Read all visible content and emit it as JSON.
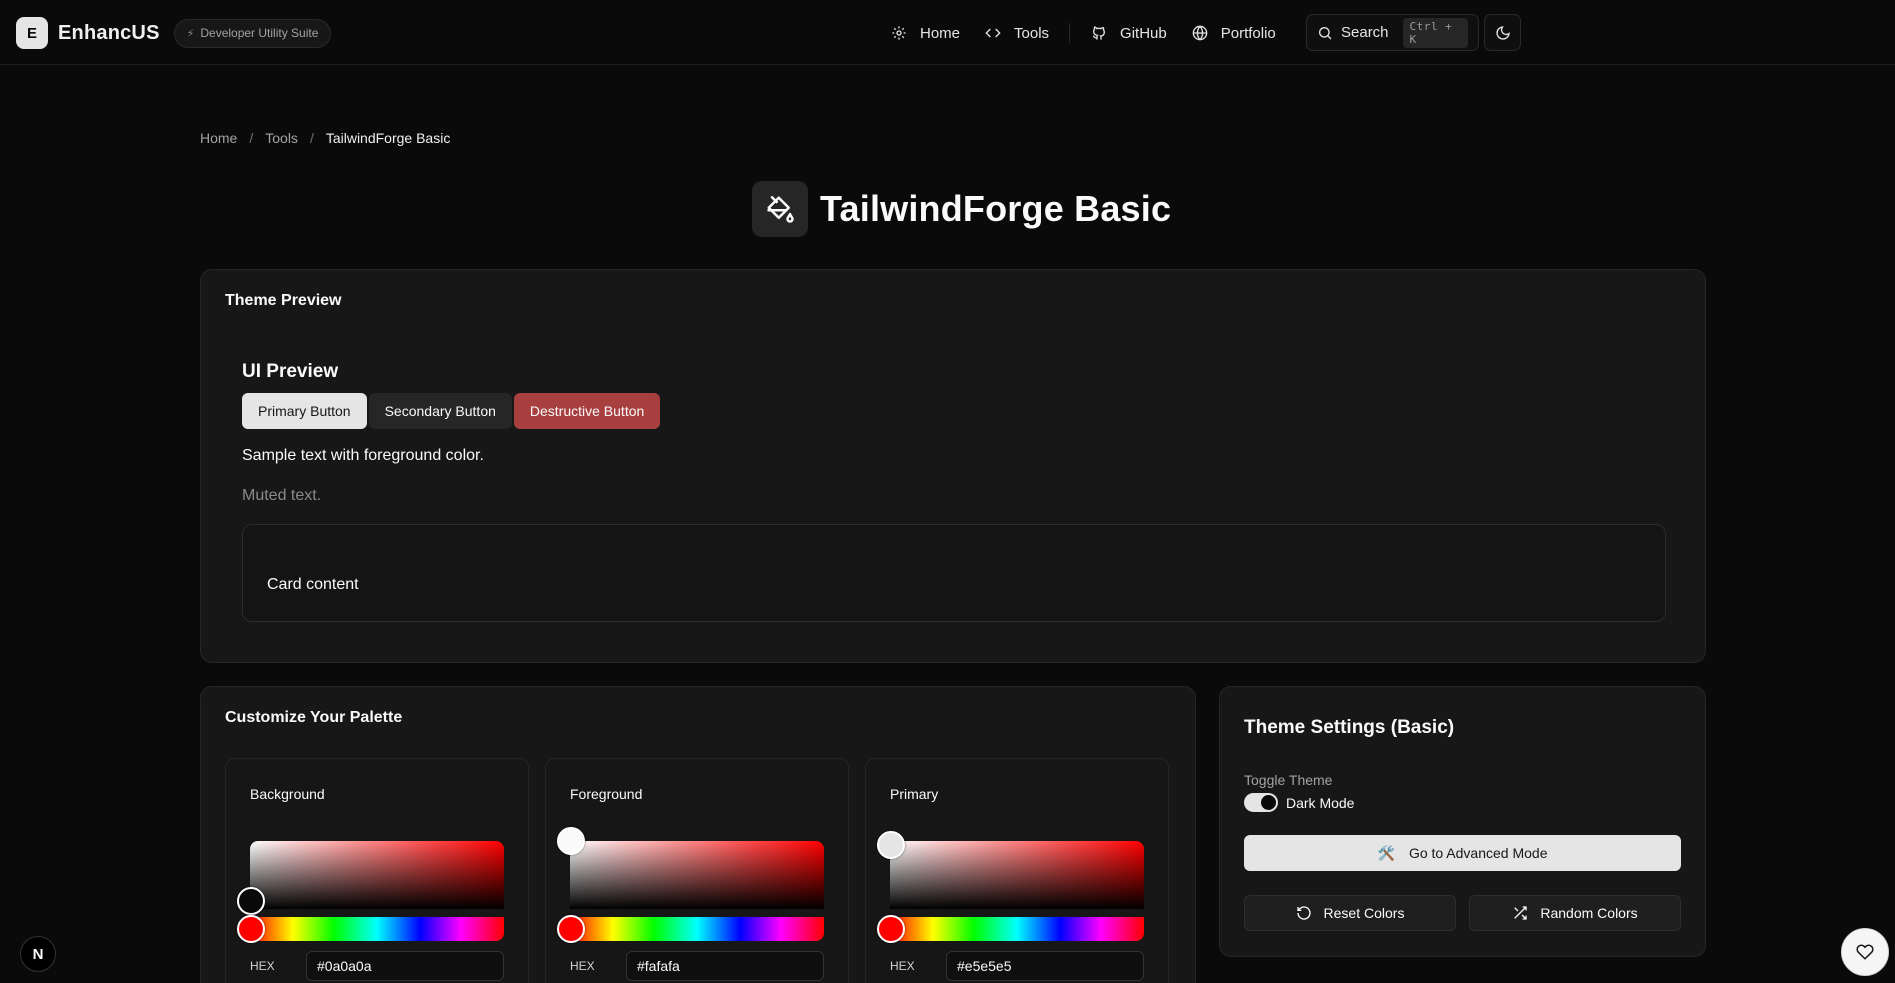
{
  "header": {
    "logo_letter": "E",
    "brand": "EnhancUS",
    "badge": "Developer Utility Suite",
    "nav": [
      {
        "label": "Home",
        "icon": "gear-icon"
      },
      {
        "label": "Tools",
        "icon": "code-icon"
      },
      {
        "label": "GitHub",
        "icon": "github-icon"
      },
      {
        "label": "Portfolio",
        "icon": "globe-icon"
      }
    ],
    "search_label": "Search",
    "search_shortcut": "Ctrl + K",
    "theme_toggle_icon": "moon-icon"
  },
  "breadcrumb": {
    "items": [
      "Home",
      "Tools"
    ],
    "separator": "/",
    "current": "TailwindForge Basic"
  },
  "page": {
    "title": "TailwindForge Basic",
    "title_icon": "paint-bucket-icon"
  },
  "preview": {
    "card_title": "Theme Preview",
    "ui_title": "UI Preview",
    "primary_button": "Primary Button",
    "secondary_button": "Secondary Button",
    "destructive_button": "Destructive Button",
    "sample_text": "Sample text with foreground color.",
    "muted_text": "Muted text.",
    "card_content": "Card content"
  },
  "palette": {
    "title": "Customize Your Palette",
    "hex_label": "HEX",
    "colors": [
      {
        "label": "Background",
        "hex": "#0a0a0a"
      },
      {
        "label": "Foreground",
        "hex": "#fafafa"
      },
      {
        "label": "Primary",
        "hex": "#e5e5e5"
      }
    ]
  },
  "settings": {
    "title": "Theme Settings (Basic)",
    "toggle_label": "Toggle Theme",
    "toggle_value": "Dark Mode",
    "toggle_on": true,
    "advanced_button": "Go to Advanced Mode",
    "advanced_icon": "🛠️",
    "reset_button": "Reset Colors",
    "random_button": "Random Colors"
  },
  "floating": {
    "next_badge": "N",
    "favorite_icon": "heart-icon"
  },
  "colors": {
    "background": "#0a0a0a",
    "card": "#171717",
    "border": "#262626",
    "primary": "#e5e5e5",
    "destructive": "#a83f3f",
    "muted": "#8a8a8a"
  }
}
